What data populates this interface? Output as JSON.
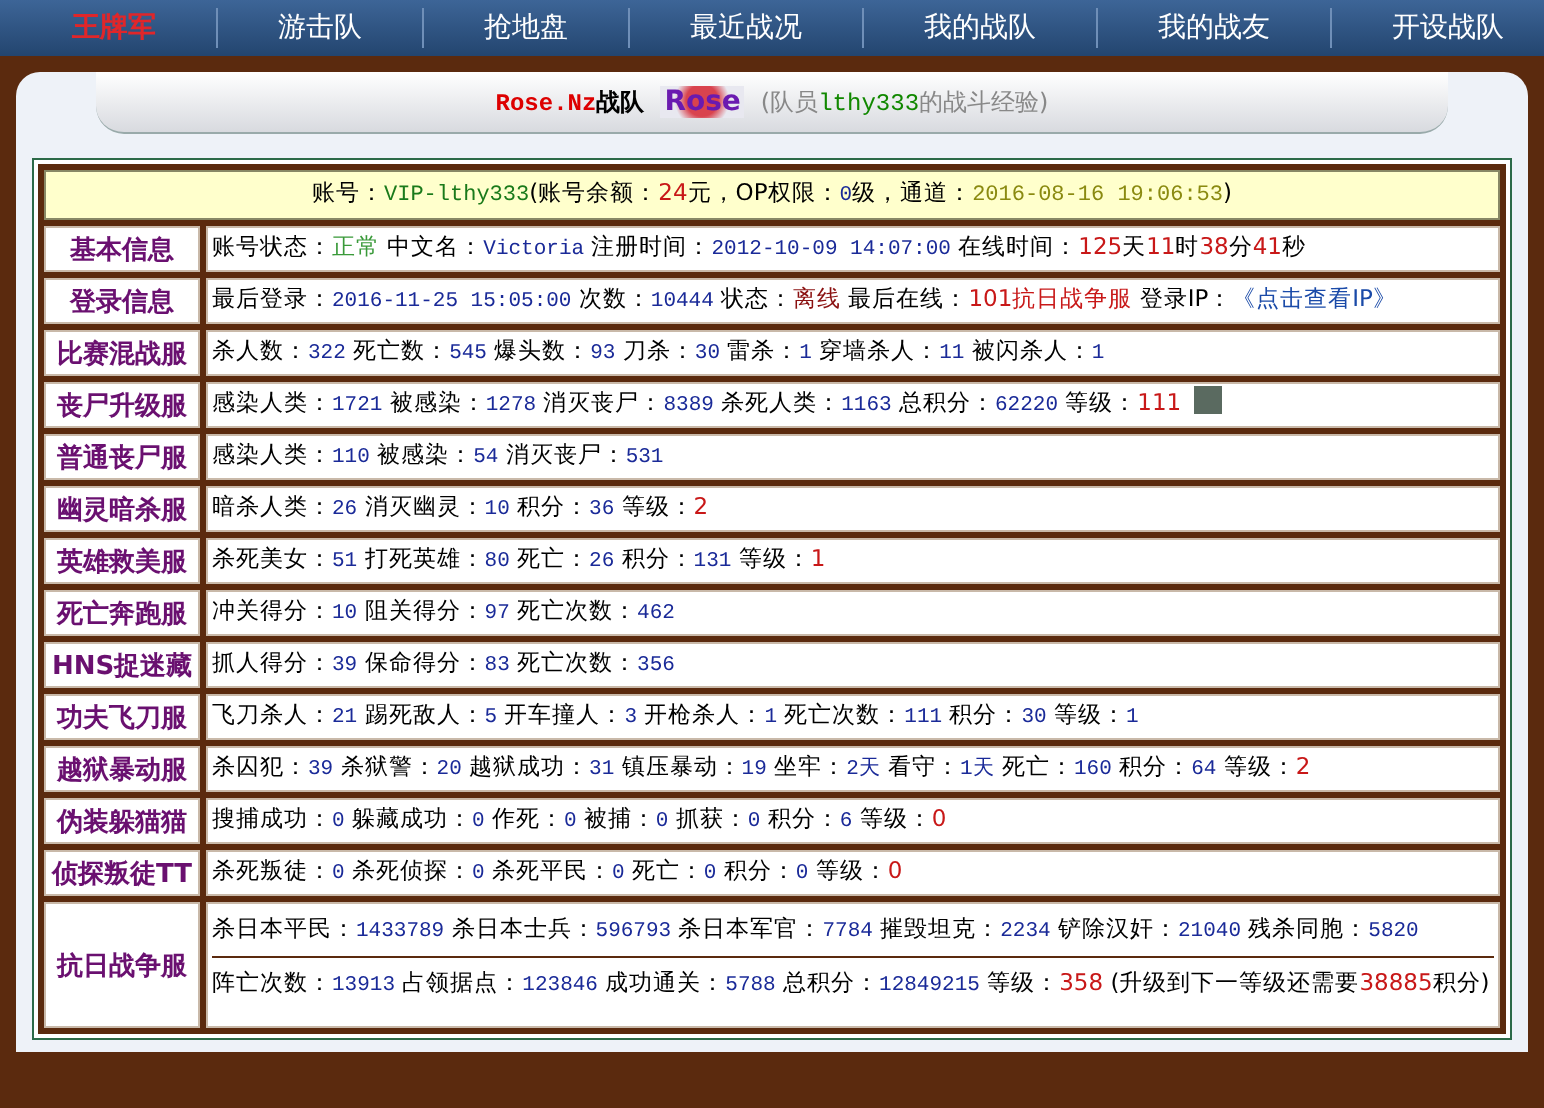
{
  "nav": {
    "logo": "王牌军",
    "items": [
      "游击队",
      "抢地盘",
      "最近战况",
      "我的战队",
      "我的战友",
      "开设战队"
    ]
  },
  "header": {
    "team": "Rose.Nz",
    "team_suffix": "战队",
    "logo_text": "Rose",
    "member_prefix": "(队员",
    "member": "lthy333",
    "member_suffix": "的战斗经验)"
  },
  "account": [
    {
      "text": "账号：",
      "kind": "plain"
    },
    {
      "text": "VIP-lthy333",
      "kind": "vip"
    },
    {
      "text": "(账号余额：",
      "kind": "plain"
    },
    {
      "text": "24",
      "kind": "lvl"
    },
    {
      "text": "元，OP权限：",
      "kind": "plain"
    },
    {
      "text": "0",
      "kind": "num"
    },
    {
      "text": "级，通道：",
      "kind": "plain"
    },
    {
      "text": "2016-08-16 19:06:53",
      "kind": "date"
    },
    {
      "text": ")",
      "kind": "plain"
    }
  ],
  "rows": [
    {
      "label": "基本信息",
      "lines": [
        [
          {
            "text": "账号状态：",
            "kind": "plain"
          },
          {
            "text": "正常",
            "kind": "ok"
          },
          {
            "text": " 中文名：",
            "kind": "plain"
          },
          {
            "text": "Victoria",
            "kind": "num"
          },
          {
            "text": " 注册时间：",
            "kind": "plain"
          },
          {
            "text": "2012-10-09 14:07:00",
            "kind": "num"
          },
          {
            "text": " 在线时间：",
            "kind": "plain"
          },
          {
            "text": "125",
            "kind": "lvl"
          },
          {
            "text": "天",
            "kind": "plain"
          },
          {
            "text": "11",
            "kind": "lvl"
          },
          {
            "text": "时",
            "kind": "plain"
          },
          {
            "text": "38",
            "kind": "lvl"
          },
          {
            "text": "分",
            "kind": "plain"
          },
          {
            "text": "41",
            "kind": "lvl"
          },
          {
            "text": "秒",
            "kind": "plain"
          }
        ]
      ]
    },
    {
      "label": "登录信息",
      "lines": [
        [
          {
            "text": "最后登录：",
            "kind": "plain"
          },
          {
            "text": "2016-11-25 15:05:00",
            "kind": "num"
          },
          {
            "text": " 次数：",
            "kind": "plain"
          },
          {
            "text": "10444",
            "kind": "num"
          },
          {
            "text": " 状态：",
            "kind": "plain"
          },
          {
            "text": "离线",
            "kind": "off"
          },
          {
            "text": " 最后在线：",
            "kind": "plain"
          },
          {
            "text": "101抗日战争服",
            "kind": "lvl"
          },
          {
            "text": " 登录IP：",
            "kind": "plain"
          },
          {
            "text": "《点击查看IP》",
            "kind": "link"
          }
        ]
      ]
    },
    {
      "label": "比赛混战服",
      "lines": [
        [
          {
            "text": "杀人数：",
            "kind": "plain"
          },
          {
            "text": "322",
            "kind": "num"
          },
          {
            "text": " 死亡数：",
            "kind": "plain"
          },
          {
            "text": "545",
            "kind": "num"
          },
          {
            "text": " 爆头数：",
            "kind": "plain"
          },
          {
            "text": "93",
            "kind": "num"
          },
          {
            "text": " 刀杀：",
            "kind": "plain"
          },
          {
            "text": "30",
            "kind": "num"
          },
          {
            "text": " 雷杀：",
            "kind": "plain"
          },
          {
            "text": "1",
            "kind": "num"
          },
          {
            "text": " 穿墙杀人：",
            "kind": "plain"
          },
          {
            "text": "11",
            "kind": "num"
          },
          {
            "text": " 被闪杀人：",
            "kind": "plain"
          },
          {
            "text": "1",
            "kind": "num"
          }
        ]
      ]
    },
    {
      "label": "丧尸升级服",
      "avatar": true,
      "lines": [
        [
          {
            "text": "感染人类：",
            "kind": "plain"
          },
          {
            "text": "1721",
            "kind": "num"
          },
          {
            "text": " 被感染：",
            "kind": "plain"
          },
          {
            "text": "1278",
            "kind": "num"
          },
          {
            "text": " 消灭丧尸：",
            "kind": "plain"
          },
          {
            "text": "8389",
            "kind": "num"
          },
          {
            "text": " 杀死人类：",
            "kind": "plain"
          },
          {
            "text": "1163",
            "kind": "num"
          },
          {
            "text": " 总积分：",
            "kind": "plain"
          },
          {
            "text": "62220",
            "kind": "num"
          },
          {
            "text": " 等级：",
            "kind": "plain"
          },
          {
            "text": "111",
            "kind": "lvl"
          }
        ]
      ]
    },
    {
      "label": "普通丧尸服",
      "lines": [
        [
          {
            "text": "感染人类：",
            "kind": "plain"
          },
          {
            "text": "110",
            "kind": "num"
          },
          {
            "text": " 被感染：",
            "kind": "plain"
          },
          {
            "text": "54",
            "kind": "num"
          },
          {
            "text": " 消灭丧尸：",
            "kind": "plain"
          },
          {
            "text": "531",
            "kind": "num"
          }
        ]
      ]
    },
    {
      "label": "幽灵暗杀服",
      "lines": [
        [
          {
            "text": "暗杀人类：",
            "kind": "plain"
          },
          {
            "text": "26",
            "kind": "num"
          },
          {
            "text": " 消灭幽灵：",
            "kind": "plain"
          },
          {
            "text": "10",
            "kind": "num"
          },
          {
            "text": " 积分：",
            "kind": "plain"
          },
          {
            "text": "36",
            "kind": "num"
          },
          {
            "text": " 等级：",
            "kind": "plain"
          },
          {
            "text": "2",
            "kind": "lvl"
          }
        ]
      ]
    },
    {
      "label": "英雄救美服",
      "lines": [
        [
          {
            "text": "杀死美女：",
            "kind": "plain"
          },
          {
            "text": "51",
            "kind": "num"
          },
          {
            "text": " 打死英雄：",
            "kind": "plain"
          },
          {
            "text": "80",
            "kind": "num"
          },
          {
            "text": " 死亡：",
            "kind": "plain"
          },
          {
            "text": "26",
            "kind": "num"
          },
          {
            "text": " 积分：",
            "kind": "plain"
          },
          {
            "text": "131",
            "kind": "num"
          },
          {
            "text": " 等级：",
            "kind": "plain"
          },
          {
            "text": "1",
            "kind": "lvl"
          }
        ]
      ]
    },
    {
      "label": "死亡奔跑服",
      "lines": [
        [
          {
            "text": "冲关得分：",
            "kind": "plain"
          },
          {
            "text": "10",
            "kind": "num"
          },
          {
            "text": " 阻关得分：",
            "kind": "plain"
          },
          {
            "text": "97",
            "kind": "num"
          },
          {
            "text": " 死亡次数：",
            "kind": "plain"
          },
          {
            "text": "462",
            "kind": "num"
          }
        ]
      ]
    },
    {
      "label": "HNS捉迷藏",
      "lines": [
        [
          {
            "text": "抓人得分：",
            "kind": "plain"
          },
          {
            "text": "39",
            "kind": "num"
          },
          {
            "text": " 保命得分：",
            "kind": "plain"
          },
          {
            "text": "83",
            "kind": "num"
          },
          {
            "text": " 死亡次数：",
            "kind": "plain"
          },
          {
            "text": "356",
            "kind": "num"
          }
        ]
      ]
    },
    {
      "label": "功夫飞刀服",
      "lines": [
        [
          {
            "text": "飞刀杀人：",
            "kind": "plain"
          },
          {
            "text": "21",
            "kind": "num"
          },
          {
            "text": " 踢死敌人：",
            "kind": "plain"
          },
          {
            "text": "5",
            "kind": "num"
          },
          {
            "text": " 开车撞人：",
            "kind": "plain"
          },
          {
            "text": "3",
            "kind": "num"
          },
          {
            "text": " 开枪杀人：",
            "kind": "plain"
          },
          {
            "text": "1",
            "kind": "num"
          },
          {
            "text": " 死亡次数：",
            "kind": "plain"
          },
          {
            "text": "111",
            "kind": "num"
          },
          {
            "text": " 积分：",
            "kind": "plain"
          },
          {
            "text": "30",
            "kind": "num"
          },
          {
            "text": " 等级：",
            "kind": "plain"
          },
          {
            "text": "1",
            "kind": "num"
          }
        ]
      ]
    },
    {
      "label": "越狱暴动服",
      "lines": [
        [
          {
            "text": "杀囚犯：",
            "kind": "plain"
          },
          {
            "text": "39",
            "kind": "num"
          },
          {
            "text": " 杀狱警：",
            "kind": "plain"
          },
          {
            "text": "20",
            "kind": "num"
          },
          {
            "text": " 越狱成功：",
            "kind": "plain"
          },
          {
            "text": "31",
            "kind": "num"
          },
          {
            "text": " 镇压暴动：",
            "kind": "plain"
          },
          {
            "text": "19",
            "kind": "num"
          },
          {
            "text": " 坐牢：",
            "kind": "plain"
          },
          {
            "text": "2天",
            "kind": "num"
          },
          {
            "text": " 看守：",
            "kind": "plain"
          },
          {
            "text": "1天",
            "kind": "num"
          },
          {
            "text": " 死亡：",
            "kind": "plain"
          },
          {
            "text": "160",
            "kind": "num"
          },
          {
            "text": " 积分：",
            "kind": "plain"
          },
          {
            "text": "64",
            "kind": "num"
          },
          {
            "text": " 等级：",
            "kind": "plain"
          },
          {
            "text": "2",
            "kind": "lvl"
          }
        ]
      ]
    },
    {
      "label": "伪装躲猫猫",
      "lines": [
        [
          {
            "text": "搜捕成功：",
            "kind": "plain"
          },
          {
            "text": "0",
            "kind": "num"
          },
          {
            "text": " 躲藏成功：",
            "kind": "plain"
          },
          {
            "text": "0",
            "kind": "num"
          },
          {
            "text": " 作死：",
            "kind": "plain"
          },
          {
            "text": "0",
            "kind": "num"
          },
          {
            "text": " 被捕：",
            "kind": "plain"
          },
          {
            "text": "0",
            "kind": "num"
          },
          {
            "text": " 抓获：",
            "kind": "plain"
          },
          {
            "text": "0",
            "kind": "num"
          },
          {
            "text": " 积分：",
            "kind": "plain"
          },
          {
            "text": "6",
            "kind": "num"
          },
          {
            "text": " 等级：",
            "kind": "plain"
          },
          {
            "text": "0",
            "kind": "lvl"
          }
        ]
      ]
    },
    {
      "label": "侦探叛徒TT",
      "lines": [
        [
          {
            "text": "杀死叛徒：",
            "kind": "plain"
          },
          {
            "text": "0",
            "kind": "num"
          },
          {
            "text": " 杀死侦探：",
            "kind": "plain"
          },
          {
            "text": "0",
            "kind": "num"
          },
          {
            "text": " 杀死平民：",
            "kind": "plain"
          },
          {
            "text": "0",
            "kind": "num"
          },
          {
            "text": " 死亡：",
            "kind": "plain"
          },
          {
            "text": "0",
            "kind": "num"
          },
          {
            "text": " 积分：",
            "kind": "plain"
          },
          {
            "text": "0",
            "kind": "num"
          },
          {
            "text": " 等级：",
            "kind": "plain"
          },
          {
            "text": "0",
            "kind": "lvl"
          }
        ]
      ]
    },
    {
      "label": "抗日战争服",
      "lines": [
        [
          {
            "text": "杀日本平民：",
            "kind": "plain"
          },
          {
            "text": "1433789",
            "kind": "num"
          },
          {
            "text": " 杀日本士兵：",
            "kind": "plain"
          },
          {
            "text": "596793",
            "kind": "num"
          },
          {
            "text": " 杀日本军官：",
            "kind": "plain"
          },
          {
            "text": "7784",
            "kind": "num"
          },
          {
            "text": " 摧毁坦克：",
            "kind": "plain"
          },
          {
            "text": "2234",
            "kind": "num"
          },
          {
            "text": " 铲除汉奸：",
            "kind": "plain"
          },
          {
            "text": "21040",
            "kind": "num"
          },
          {
            "text": " 残杀同胞：",
            "kind": "plain"
          },
          {
            "text": "5820",
            "kind": "num"
          }
        ],
        [
          {
            "text": "阵亡次数：",
            "kind": "plain"
          },
          {
            "text": "13913",
            "kind": "num"
          },
          {
            "text": " 占领据点：",
            "kind": "plain"
          },
          {
            "text": "123846",
            "kind": "num"
          },
          {
            "text": " 成功通关：",
            "kind": "plain"
          },
          {
            "text": "5788",
            "kind": "num"
          },
          {
            "text": " 总积分：",
            "kind": "plain"
          },
          {
            "text": "12849215",
            "kind": "num"
          },
          {
            "text": " 等级：",
            "kind": "plain"
          },
          {
            "text": "358",
            "kind": "lvl"
          },
          {
            "text": " (升级到下一等级还需要",
            "kind": "plain"
          },
          {
            "text": "38885",
            "kind": "lvl"
          },
          {
            "text": "积分)",
            "kind": "plain"
          }
        ]
      ]
    }
  ]
}
